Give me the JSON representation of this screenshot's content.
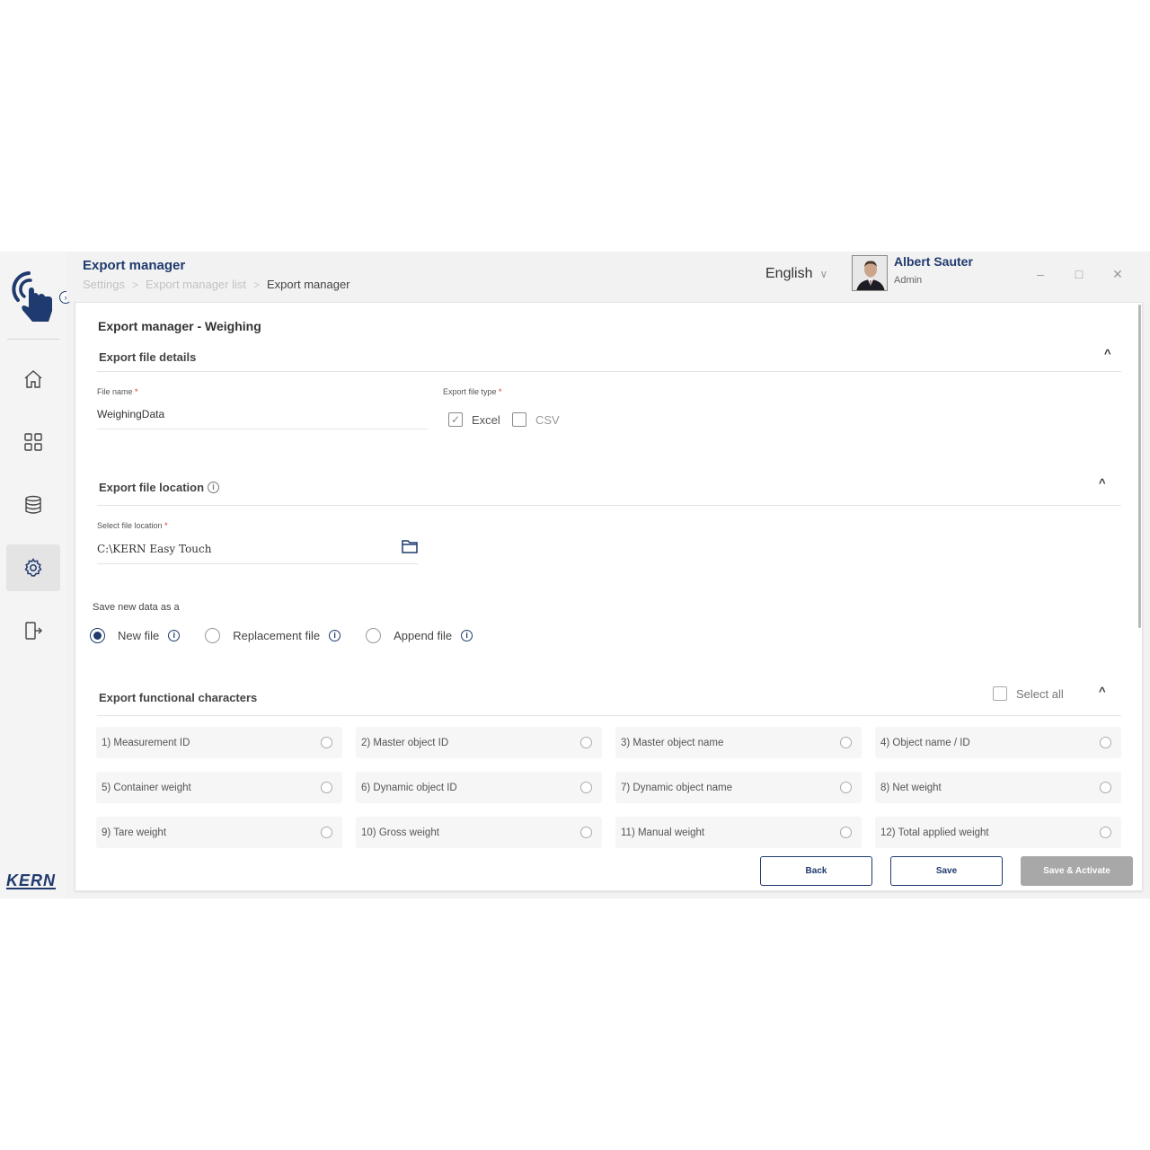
{
  "header": {
    "title": "Export manager",
    "breadcrumb": [
      "Settings",
      "Export manager list",
      "Export manager"
    ],
    "language": "English",
    "user_name": "Albert Sauter",
    "user_role": "Admin"
  },
  "sidebar": {
    "brand": "KERN",
    "items": [
      {
        "icon": "home-icon"
      },
      {
        "icon": "dashboard-icon"
      },
      {
        "icon": "database-icon"
      },
      {
        "icon": "settings-gear-icon",
        "active": true
      },
      {
        "icon": "logout-icon"
      }
    ]
  },
  "panel": {
    "title": "Export manager - Weighing",
    "file_details": {
      "title": "Export file details",
      "file_name_label": "File name",
      "file_name_value": "WeighingData",
      "file_type_label": "Export file type",
      "excel_label": "Excel",
      "excel_checked": true,
      "csv_label": "CSV",
      "csv_checked": false
    },
    "file_location": {
      "title": "Export file location",
      "select_label": "Select file location",
      "path": "C:\\KERN Easy Touch"
    },
    "save_as": {
      "label": "Save new data as a",
      "options": [
        "New file",
        "Replacement file",
        "Append file"
      ],
      "selected": "New file"
    },
    "functional": {
      "title": "Export functional characters",
      "select_all": "Select all",
      "items": [
        "1)  Measurement ID",
        "2)  Master object ID",
        "3)  Master object name",
        "4)  Object name / ID",
        "5)  Container weight",
        "6)  Dynamic object ID",
        "7)  Dynamic object name",
        "8)  Net weight",
        "9)  Tare weight",
        "10)  Gross weight",
        "11)  Manual weight",
        "12)  Total applied weight"
      ]
    },
    "buttons": {
      "back": "Back",
      "save": "Save",
      "save_activate": "Save & Activate"
    }
  },
  "colors": {
    "brand": "#1f3a6e",
    "disabled_button": "#a8a8a8",
    "required": "#d33333"
  }
}
